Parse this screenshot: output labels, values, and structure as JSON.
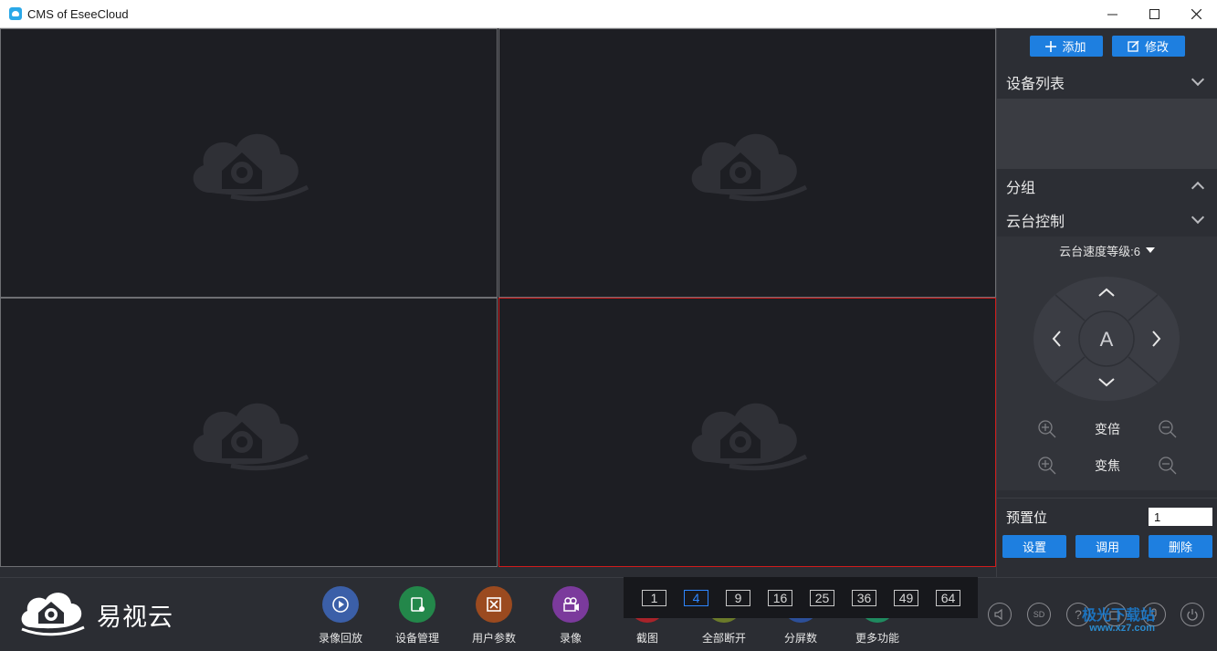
{
  "window": {
    "title": "CMS of EseeCloud",
    "minimize": "—",
    "maximize": "☐",
    "close": "✕"
  },
  "panel": {
    "add_label": "添加",
    "edit_label": "修改",
    "device_list_title": "设备列表",
    "group_title": "分组",
    "ptz_title": "云台控制",
    "ptz_speed": "云台速度等级:6",
    "joystick_center": "A",
    "zoom_label": "变倍",
    "focus_label": "变焦",
    "preset_label": "预置位",
    "preset_value": "1",
    "preset_set": "设置",
    "preset_call": "调用",
    "preset_delete": "删除"
  },
  "toolbar": {
    "brand": "易视云",
    "tools": [
      {
        "label": "录像回放",
        "icon": "playback-icon",
        "color": "#3b5fa8"
      },
      {
        "label": "设备管理",
        "icon": "device-manage-icon",
        "color": "#23874a"
      },
      {
        "label": "用户参数",
        "icon": "user-params-icon",
        "color": "#9b4a1f"
      },
      {
        "label": "录像",
        "icon": "record-icon",
        "color": "#7b3a9c"
      },
      {
        "label": "截图",
        "icon": "screenshot-icon",
        "color": "#a8232a"
      },
      {
        "label": "全部断开",
        "icon": "disconnect-all-icon",
        "color": "#6b7a2a"
      },
      {
        "label": "分屏数",
        "icon": "split-screen-icon",
        "color": "#2c4f99"
      },
      {
        "label": "更多功能",
        "icon": "more-icon",
        "color": "#1f8a5f"
      }
    ],
    "split_options": [
      "1",
      "4",
      "9",
      "16",
      "25",
      "36",
      "49",
      "64"
    ],
    "active_split": "4",
    "sd_label": "SD"
  },
  "watermark": {
    "text": "极光下载站",
    "url": "www.xz7.com"
  },
  "colors": {
    "accent": "#1e7fe0",
    "active_cell": "#d01c1c"
  }
}
